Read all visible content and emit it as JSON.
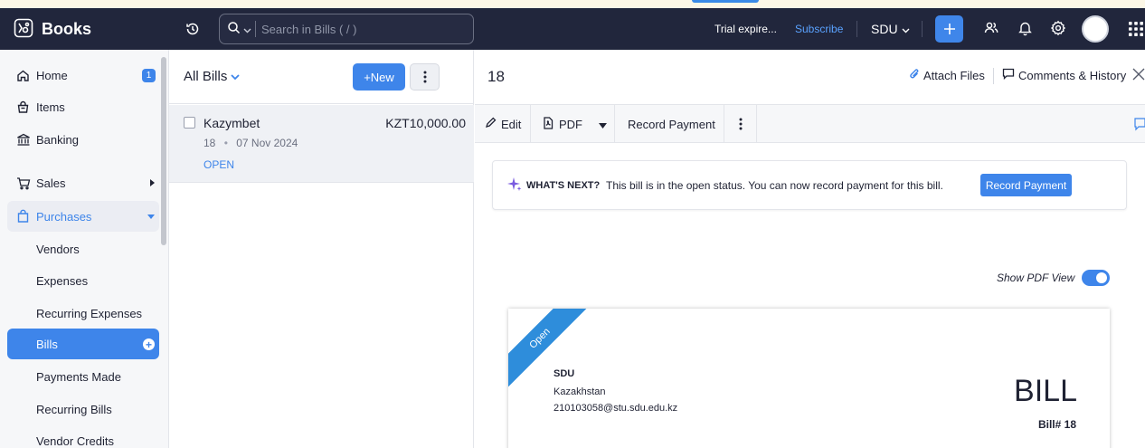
{
  "app": {
    "name": "Books"
  },
  "header": {
    "search_placeholder": "Search in Bills ( / )",
    "trial_text": "Trial expire...",
    "subscribe_label": "Subscribe",
    "org_name": "SDU"
  },
  "sidebar": {
    "home": {
      "label": "Home",
      "badge": "1"
    },
    "items": {
      "label": "Items"
    },
    "banking": {
      "label": "Banking"
    },
    "sales": {
      "label": "Sales"
    },
    "purchases": {
      "label": "Purchases"
    },
    "sub": {
      "vendors": "Vendors",
      "expenses": "Expenses",
      "recurring_expenses": "Recurring Expenses",
      "bills": "Bills",
      "payments_made": "Payments Made",
      "recurring_bills": "Recurring Bills",
      "vendor_credits": "Vendor Credits"
    }
  },
  "list": {
    "title": "All Bills",
    "new_label": "+New",
    "bill": {
      "vendor": "Kazymbet",
      "amount": "KZT10,000.00",
      "number": "18",
      "date": "07 Nov 2024",
      "status": "OPEN"
    }
  },
  "detail": {
    "title": "18",
    "attach_label": "Attach Files",
    "comments_label": "Comments & History",
    "toolbar": {
      "edit": "Edit",
      "pdf": "PDF",
      "record_payment": "Record Payment"
    },
    "whats_next": {
      "heading": "WHAT'S NEXT?",
      "message": "This bill is in the open status. You can now record payment for this bill.",
      "button": "Record Payment"
    },
    "show_pdf_label": "Show PDF View",
    "show_pdf_enabled": true,
    "pdf": {
      "ribbon": "Open",
      "org_name": "SDU",
      "org_country": "Kazakhstan",
      "org_email": "210103058@stu.sdu.edu.kz",
      "doc_title": "BILL",
      "bill_number": "Bill# 18"
    }
  },
  "colors": {
    "accent": "#3e85ea",
    "header_bg": "#21263c",
    "ribbon": "#2e8ddb"
  }
}
